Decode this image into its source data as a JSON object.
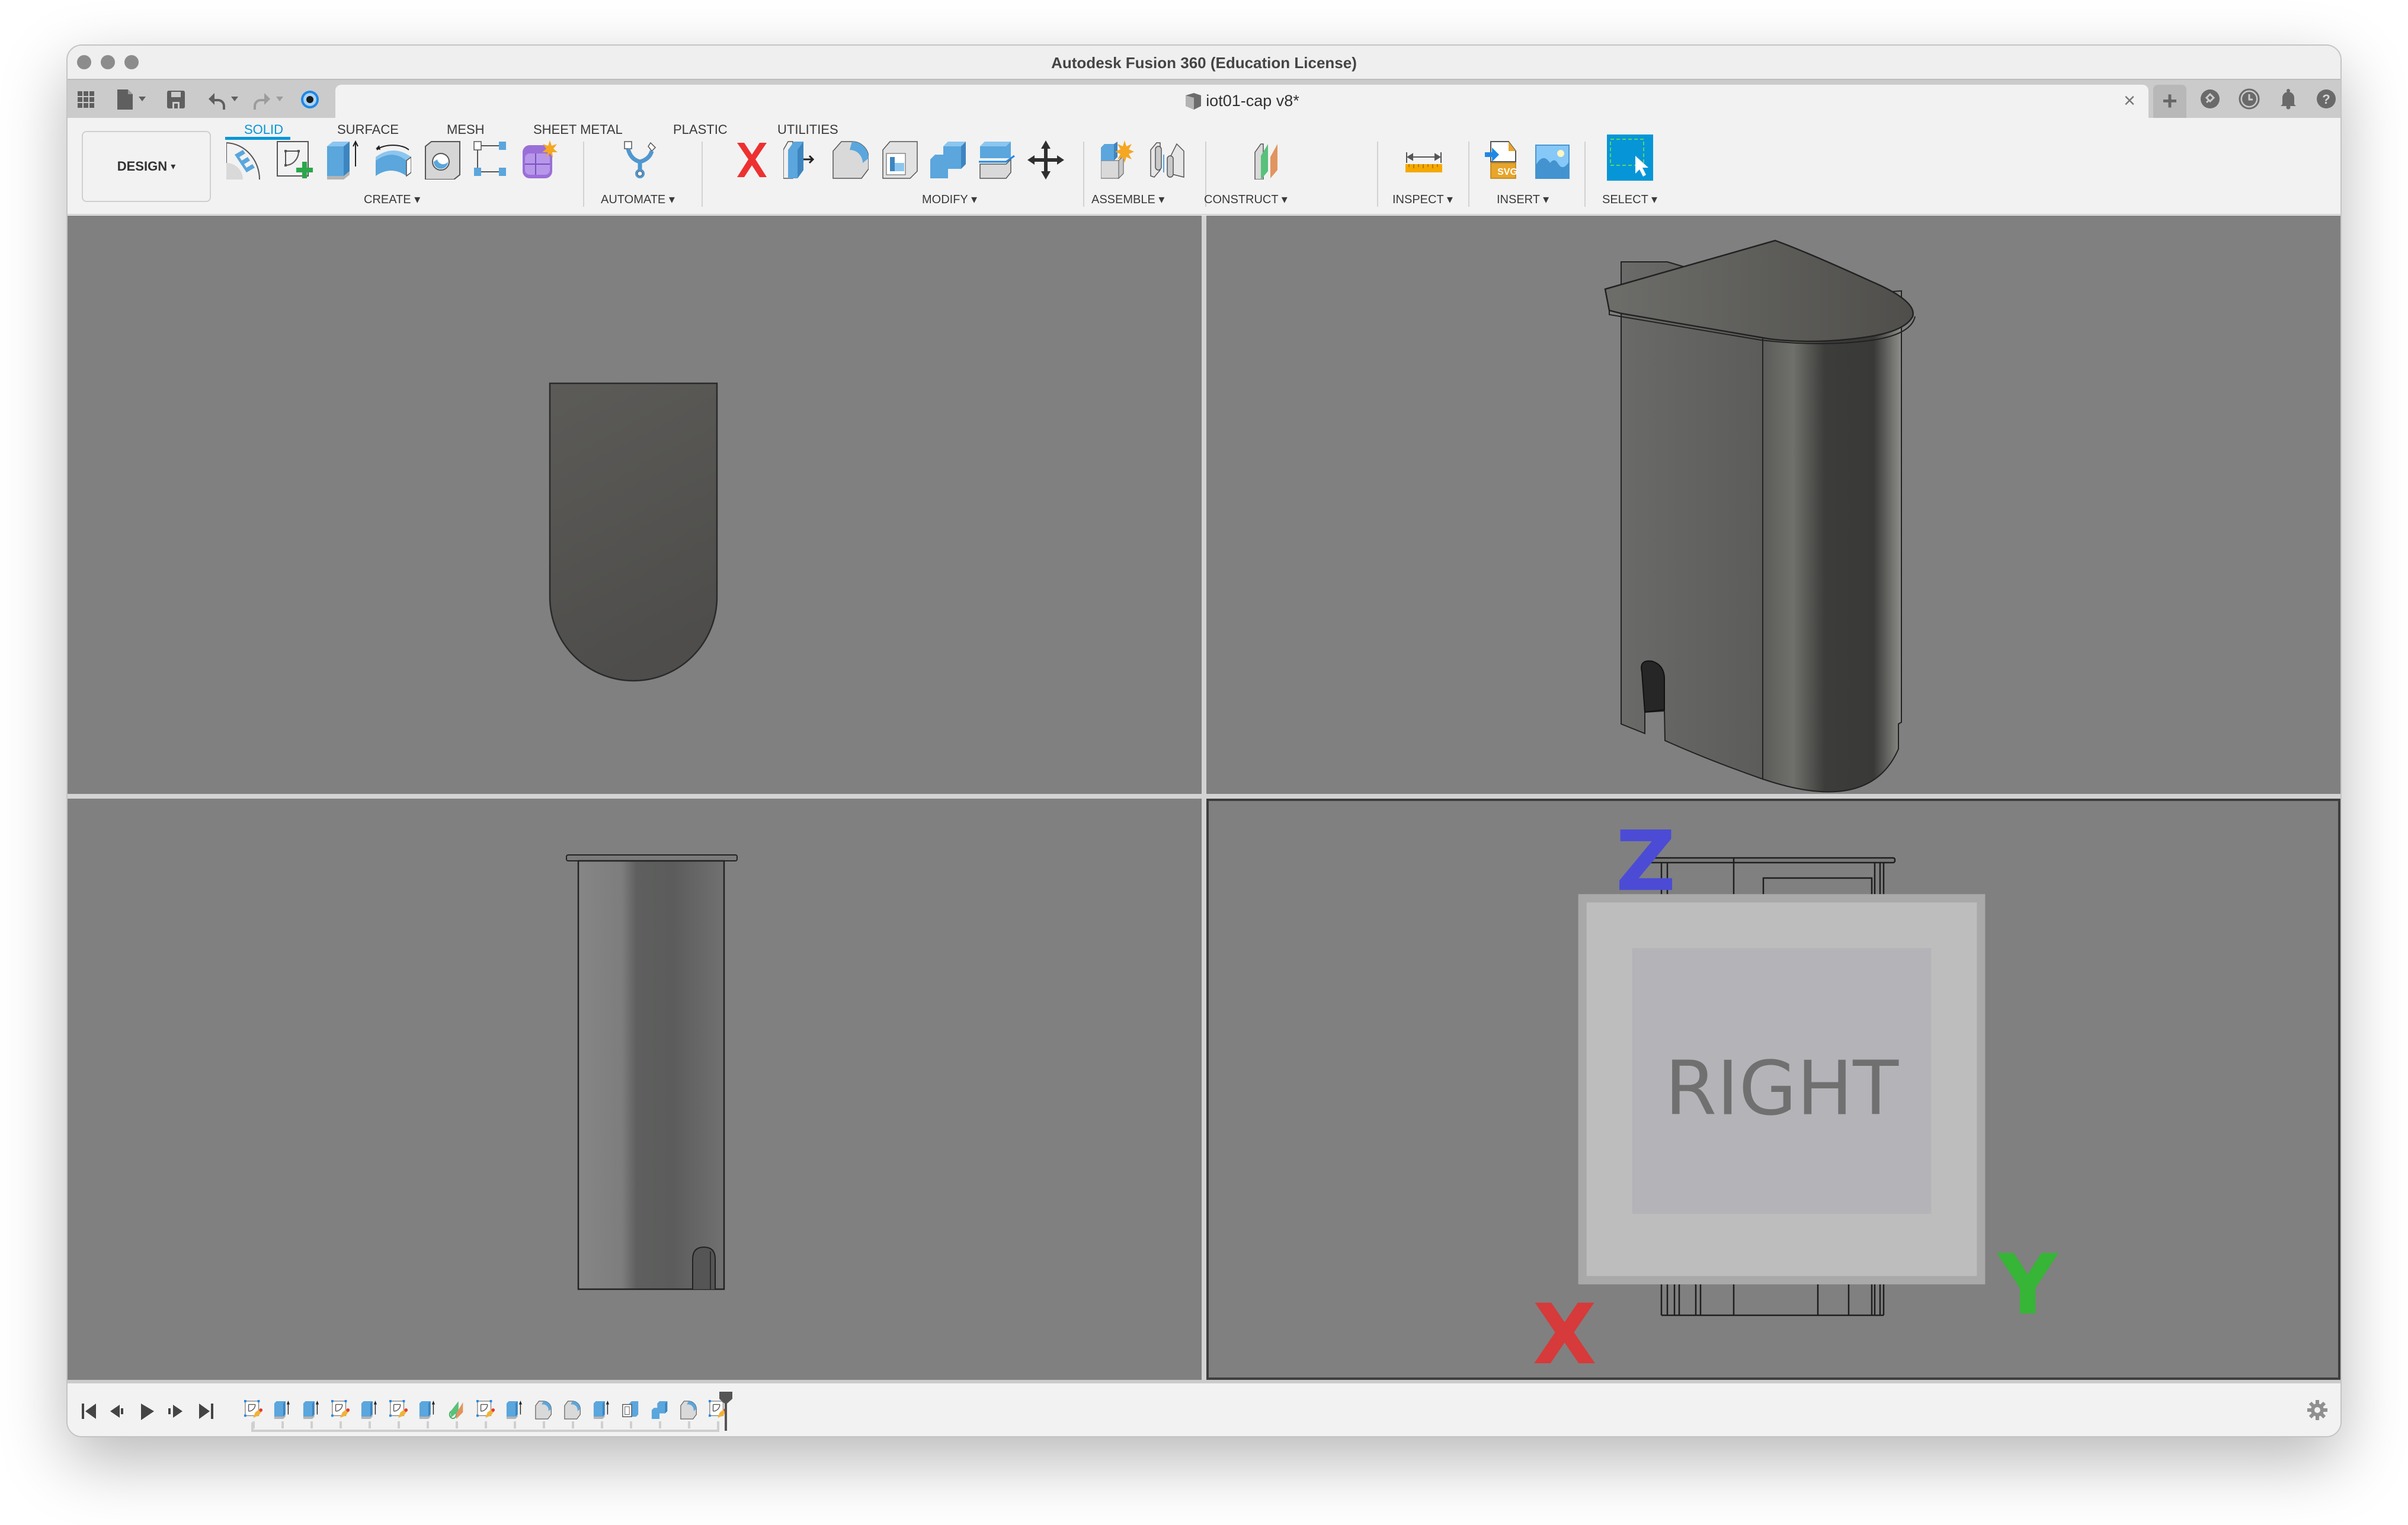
{
  "window": {
    "title": "Autodesk Fusion 360 (Education License)"
  },
  "quick_access": {
    "icons": [
      "app-grid-icon",
      "file-icon",
      "save-icon",
      "undo-icon",
      "redo-icon",
      "job-status-icon"
    ]
  },
  "document_tab": {
    "label": "iot01-cap v8*",
    "icon": "component-cube-icon",
    "close_label": "×"
  },
  "header_right": {
    "new_tab_label": "+",
    "icons": [
      "extensions-icon",
      "job-history-icon",
      "notifications-icon",
      "help-icon",
      "user-avatar-icon"
    ]
  },
  "workspace": {
    "label": "DESIGN",
    "caret": "▾"
  },
  "ribbon_tabs": [
    {
      "label": "SOLID",
      "active": true
    },
    {
      "label": "SURFACE",
      "active": false
    },
    {
      "label": "MESH",
      "active": false
    },
    {
      "label": "SHEET METAL",
      "active": false
    },
    {
      "label": "PLASTIC",
      "active": false
    },
    {
      "label": "UTILITIES",
      "active": false
    }
  ],
  "tool_groups": [
    {
      "label": "CREATE ▾",
      "tools": [
        "create-form-icon",
        "create-sketch-icon",
        "extrude-icon",
        "revolve-icon",
        "hole-icon",
        "pattern-icon",
        "new-component-icon"
      ]
    },
    {
      "label": "AUTOMATE ▾",
      "tools": [
        "automate-icon"
      ]
    },
    {
      "label": "MODIFY ▾",
      "tools": [
        "delete-icon",
        "press-pull-icon",
        "fillet-icon",
        "shell-icon",
        "combine-icon",
        "split-body-icon",
        "move-copy-icon"
      ]
    },
    {
      "label": "ASSEMBLE ▾",
      "tools": [
        "new-component-assemble-icon",
        "joint-icon"
      ]
    },
    {
      "label": "CONSTRUCT ▾",
      "tools": [
        "offset-plane-icon"
      ]
    },
    {
      "label": "INSPECT ▾",
      "tools": [
        "measure-icon"
      ]
    },
    {
      "label": "INSERT ▾",
      "tools": [
        "insert-svg-icon",
        "insert-canvas-icon"
      ]
    },
    {
      "label": "SELECT ▾",
      "tools": [
        "window-select-icon"
      ]
    }
  ],
  "viewports": [
    {
      "name": "top-view",
      "active": false
    },
    {
      "name": "home-view",
      "active": false
    },
    {
      "name": "front-view",
      "active": false
    },
    {
      "name": "right-view",
      "active": true,
      "viewcube_label": "RIGHT"
    }
  ],
  "viewcube": {
    "label": "RIGHT",
    "axes": {
      "z": "Z",
      "y": "Y",
      "x": "X"
    },
    "axis_colors": {
      "z": "#4b4bd6",
      "y": "#36b536",
      "x": "#d63a3a"
    }
  },
  "playback": {
    "controls": [
      "go-to-start",
      "step-back",
      "play",
      "step-forward",
      "go-to-end"
    ]
  },
  "timeline": {
    "features": [
      "sketch",
      "extrude",
      "extrude",
      "sketch",
      "extrude",
      "sketch",
      "extrude",
      "plane",
      "sketch",
      "extrude",
      "fillet",
      "fillet",
      "extrude",
      "shell",
      "combine",
      "fillet",
      "sketch"
    ]
  },
  "colors": {
    "accent": "#0696d7",
    "viewport_bg": "#808080",
    "body_dark": "#4f4f4f",
    "window_bg": "#f1f1f1"
  }
}
